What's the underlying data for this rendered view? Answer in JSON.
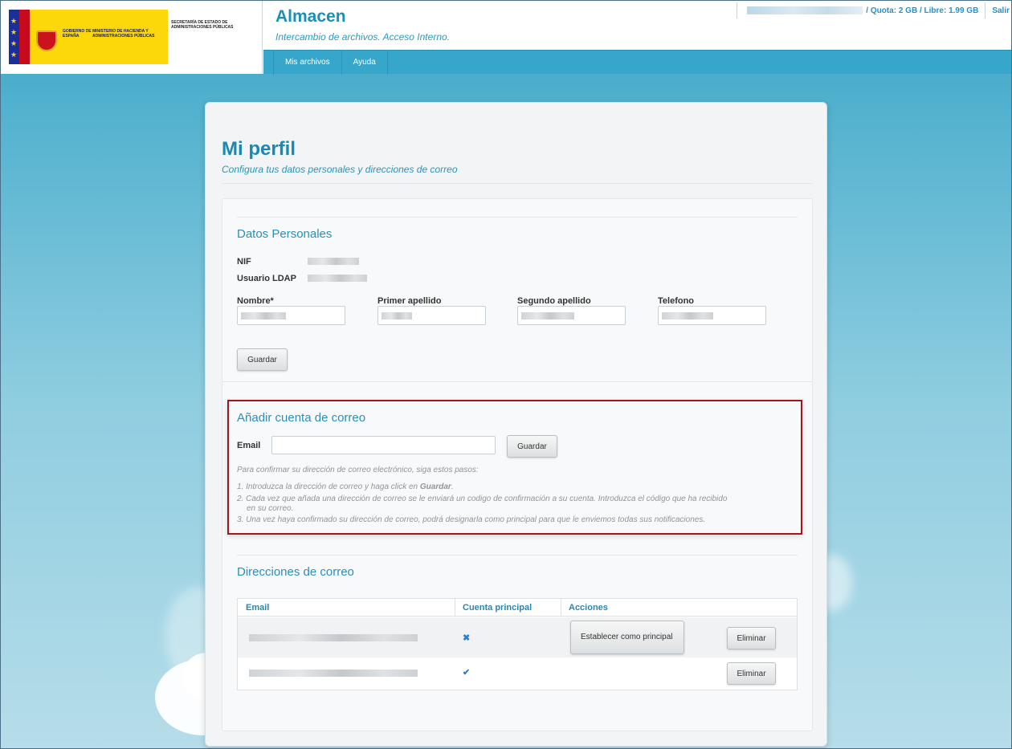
{
  "header": {
    "logo": {
      "gobierno": "GOBIERNO DE ESPAÑA",
      "ministerio": "MINISTERIO DE HACIENDA Y ADMINISTRACIONES PÚBLICAS",
      "secretaria": "SECRETARÍA DE ESTADO DE ADMINISTRACIONES PÚBLICAS"
    },
    "app_title": "Almacen",
    "app_subtitle": "Intercambio de archivos. Acceso Interno.",
    "quota": "/ Quota: 2 GB / Libre: 1.99 GB",
    "logout": "Salir",
    "nav": [
      "Mis archivos",
      "Ayuda"
    ]
  },
  "page": {
    "title": "Mi perfil",
    "subtitle": "Configura tus datos personales y direcciones de correo"
  },
  "personal": {
    "section_title": "Datos Personales",
    "nif_label": "NIF",
    "ldap_label": "Usuario LDAP",
    "fields": {
      "nombre": "Nombre*",
      "primer_apellido": "Primer apellido",
      "segundo_apellido": "Segundo apellido",
      "telefono": "Telefono"
    },
    "save_label": "Guardar"
  },
  "add_email": {
    "section_title": "Añadir cuenta de correo",
    "email_label": "Email",
    "email_value": "",
    "save_label": "Guardar",
    "help_intro": "Para confirmar su dirección de correo electrónico, siga estos pasos:",
    "step1_prefix": "1.  Introduzca la dirección de correo y haga click en ",
    "step1_bold": "Guardar",
    "step1_suffix": ".",
    "step2": "2.  Cada vez que añada una dirección de correo se le enviará un codigo de confirmación a su cuenta. Introduzca el código que ha recibido",
    "step2_cont": "en su correo.",
    "step3": "3.  Una vez haya confirmado su dirección de correo, podrá designarla como principal para que le enviemos todas sus notificaciones."
  },
  "emails": {
    "section_title": "Direcciones de correo",
    "columns": [
      "Email",
      "Cuenta principal",
      "Acciones"
    ],
    "rows": [
      {
        "principal_mark": "✖",
        "action_primary": "Establecer como principal",
        "action_delete": "Eliminar"
      },
      {
        "principal_mark": "✔",
        "action_delete": "Eliminar"
      }
    ]
  },
  "colors": {
    "accent": "#1b88b2",
    "nav_bar": "#36a6cb",
    "highlight_border": "#a3151b"
  }
}
